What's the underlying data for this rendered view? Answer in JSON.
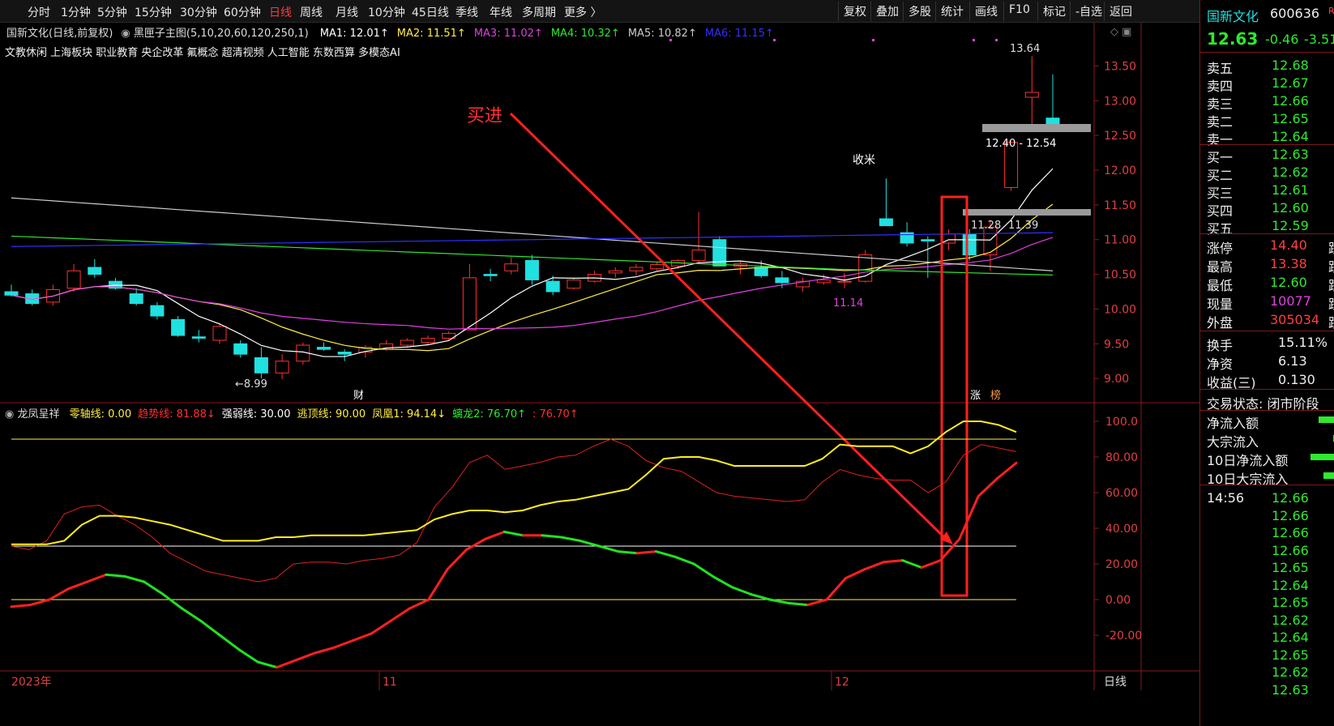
{
  "toolbar": {
    "periods": [
      "分时",
      "1分钟",
      "5分钟",
      "15分钟",
      "30分钟",
      "60分钟",
      "日线",
      "周线",
      "月线",
      "10分钟",
      "45日线",
      "季线",
      "年线",
      "多周期",
      "更多 〉"
    ],
    "active_period": "日线",
    "buttons": [
      "复权",
      "叠加",
      "多股",
      "统计",
      "画线",
      "F10",
      "标记",
      "-自选",
      "返回"
    ]
  },
  "main_chart": {
    "title": "国新文化(日线,前复权)",
    "indicator_name": "黑匣子主图(5,10,20,60,120,250,1)",
    "ma": [
      {
        "label": "MA1: 12.01",
        "color": "#ffffff"
      },
      {
        "label": "MA2: 11.51",
        "color": "#ffee44"
      },
      {
        "label": "MA3: 11.02",
        "color": "#e040e0"
      },
      {
        "label": "MA4: 10.32",
        "color": "#2ee92e"
      },
      {
        "label": "MA5: 10.82",
        "color": "#cccccc"
      },
      {
        "label": "MA6: 11.15",
        "color": "#3030ff"
      }
    ],
    "concepts": "文教休闲 上海板块 职业教育 央企改革 氟概念 超清视频 人工智能 东数西算 多模态AI",
    "y_ticks": [
      "13.50",
      "13.00",
      "12.50",
      "12.00",
      "11.50",
      "11.00",
      "10.50",
      "10.00",
      "9.50",
      "9.00"
    ],
    "annotation_buy": "买进",
    "annotation_shoumi": "收米",
    "high_label": "13.64",
    "low_label": "←8.99",
    "range_label": "12.40 - 12.54",
    "range_label2": "11.28",
    "range_label3": "11.39",
    "marker_1114": "11.14",
    "cai_label": "财",
    "zhang_label": "涨",
    "bang_label": "榜"
  },
  "sub_chart": {
    "name": "龙凤呈祥",
    "items": [
      {
        "label": "零轴线: 0.00",
        "color": "#ffee44"
      },
      {
        "label": "趋势线: 81.88↓",
        "color": "#ff3030"
      },
      {
        "label": "强弱线: 30.00",
        "color": "#ffffff"
      },
      {
        "label": "逃顶线: 90.00",
        "color": "#ffee44"
      },
      {
        "label": "凤凰1: 94.14↓",
        "color": "#ffee44"
      },
      {
        "label": "螭龙2: 76.70↑",
        "color": "#2ee92e"
      },
      {
        "label": ": 76.70↑",
        "color": "#ff3030"
      }
    ],
    "y_ticks": [
      "100.0",
      "80.00",
      "60.00",
      "40.00",
      "20.00",
      "0.00",
      "-20.00"
    ]
  },
  "x_axis": {
    "labels": [
      "2023年",
      "11",
      "12"
    ],
    "period_label": "日线"
  },
  "chart_data": {
    "type": "candlestick",
    "ylim": [
      8.85,
      13.75
    ],
    "candles": [
      [
        10.25,
        10.35,
        10.18,
        10.2
      ],
      [
        10.22,
        10.28,
        10.05,
        10.08
      ],
      [
        10.1,
        10.35,
        10.05,
        10.28
      ],
      [
        10.3,
        10.65,
        10.25,
        10.55
      ],
      [
        10.6,
        10.72,
        10.45,
        10.5
      ],
      [
        10.4,
        10.45,
        10.28,
        10.3
      ],
      [
        10.22,
        10.3,
        10.05,
        10.08
      ],
      [
        10.05,
        10.1,
        9.85,
        9.9
      ],
      [
        9.85,
        9.9,
        9.6,
        9.62
      ],
      [
        9.6,
        9.7,
        9.52,
        9.58
      ],
      [
        9.55,
        9.8,
        9.5,
        9.75
      ],
      [
        9.5,
        9.55,
        9.3,
        9.35
      ],
      [
        9.3,
        9.45,
        9.0,
        9.08
      ],
      [
        9.08,
        9.35,
        8.99,
        9.25
      ],
      [
        9.25,
        9.52,
        9.2,
        9.48
      ],
      [
        9.45,
        9.52,
        9.4,
        9.42
      ],
      [
        9.38,
        9.42,
        9.25,
        9.35
      ],
      [
        9.38,
        9.48,
        9.3,
        9.45
      ],
      [
        9.42,
        9.55,
        9.4,
        9.5
      ],
      [
        9.48,
        9.58,
        9.45,
        9.55
      ],
      [
        9.52,
        9.62,
        9.48,
        9.58
      ],
      [
        9.58,
        9.68,
        9.55,
        9.65
      ],
      [
        9.7,
        10.65,
        9.7,
        10.45
      ],
      [
        10.5,
        10.58,
        10.4,
        10.48
      ],
      [
        10.55,
        10.75,
        10.5,
        10.65
      ],
      [
        10.7,
        10.78,
        10.35,
        10.42
      ],
      [
        10.4,
        10.48,
        10.2,
        10.25
      ],
      [
        10.3,
        10.45,
        10.28,
        10.42
      ],
      [
        10.4,
        10.55,
        10.38,
        10.5
      ],
      [
        10.52,
        10.6,
        10.45,
        10.55
      ],
      [
        10.55,
        10.65,
        10.48,
        10.6
      ],
      [
        10.58,
        10.68,
        10.55,
        10.64
      ],
      [
        10.62,
        10.72,
        10.58,
        10.7
      ],
      [
        10.7,
        11.4,
        10.65,
        10.85
      ],
      [
        11.0,
        11.05,
        10.65,
        10.62
      ],
      [
        10.62,
        10.68,
        10.5,
        10.65
      ],
      [
        10.6,
        10.7,
        10.45,
        10.48
      ],
      [
        10.45,
        10.55,
        10.3,
        10.38
      ],
      [
        10.32,
        10.45,
        10.25,
        10.4
      ],
      [
        10.38,
        10.5,
        10.35,
        10.42
      ],
      [
        10.4,
        10.52,
        10.3,
        10.4
      ],
      [
        10.4,
        10.85,
        10.38,
        10.78
      ],
      [
        11.3,
        11.88,
        11.25,
        11.2
      ],
      [
        11.1,
        11.25,
        10.9,
        10.95
      ],
      [
        11.0,
        11.05,
        10.45,
        10.98
      ],
      [
        10.95,
        11.15,
        10.85,
        11.08
      ],
      [
        11.08,
        11.15,
        10.7,
        10.78
      ],
      [
        10.78,
        11.28,
        10.55,
        11.18
      ],
      [
        11.75,
        12.4,
        11.7,
        12.4
      ],
      [
        13.05,
        13.64,
        12.6,
        13.12
      ],
      [
        12.75,
        13.38,
        12.6,
        12.63
      ]
    ],
    "osc_red_thin": [
      30,
      28,
      33,
      48,
      52,
      53,
      47,
      42,
      35,
      26,
      21,
      16,
      14,
      12,
      10,
      12,
      20,
      21,
      21,
      20,
      22,
      23,
      25,
      32,
      52,
      63,
      77,
      81,
      73,
      75,
      77,
      80,
      81,
      86,
      90,
      86,
      78,
      74,
      72,
      66,
      60,
      58,
      57,
      56,
      55,
      56,
      66,
      73,
      70,
      68,
      67,
      67,
      60,
      66,
      81,
      87,
      85,
      83
    ],
    "osc_yellow": [
      31,
      31,
      31,
      33,
      42,
      47,
      47,
      46,
      44,
      42,
      39,
      36,
      33,
      33,
      33,
      35,
      35,
      36,
      36,
      36,
      36,
      37,
      38,
      39,
      45,
      48,
      50,
      50,
      49,
      50,
      53,
      55,
      56,
      58,
      60,
      62,
      70,
      79,
      80,
      80,
      78,
      75,
      75,
      75,
      75,
      75,
      79,
      87,
      86,
      86,
      86,
      82,
      86,
      94,
      100,
      100,
      98,
      94
    ],
    "osc_main": [
      -4,
      -3,
      0,
      6,
      10,
      14,
      13,
      10,
      3,
      -5,
      -12,
      -20,
      -28,
      -35,
      -38,
      -34,
      -30,
      -27,
      -23,
      -19,
      -12,
      -5,
      0,
      17,
      28,
      34,
      38,
      36,
      36,
      35,
      33,
      30,
      27,
      26,
      27,
      24,
      20,
      13,
      7,
      3,
      0,
      -2,
      -3,
      0,
      12,
      17,
      21,
      22,
      18,
      22,
      34,
      58,
      68,
      76.7
    ]
  }
}
